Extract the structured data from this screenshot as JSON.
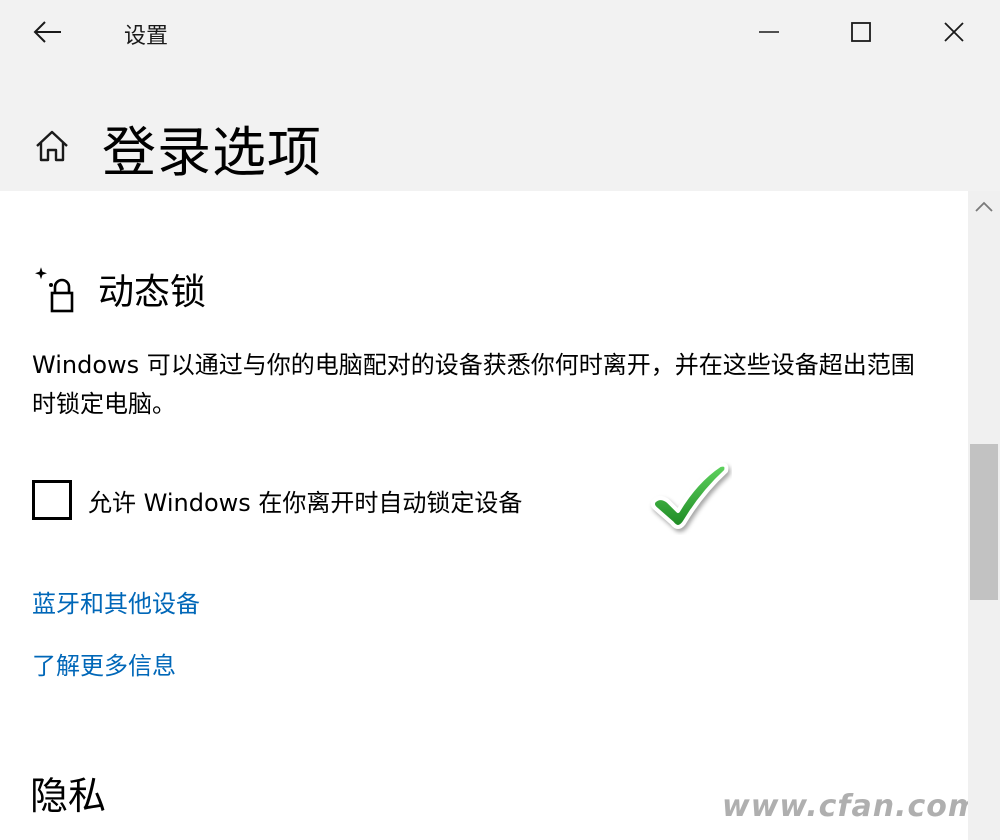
{
  "window": {
    "app_title": "设置"
  },
  "header": {
    "page_title": "登录选项"
  },
  "dynamic_lock": {
    "heading": "动态锁",
    "description": "Windows 可以通过与你的电脑配对的设备获悉你何时离开，并在这些设备超出范围时锁定电脑。",
    "checkbox_label": "允许 Windows 在你离开时自动锁定设备",
    "checkbox_checked": false,
    "links": {
      "bluetooth": "蓝牙和其他设备",
      "learn_more": "了解更多信息"
    }
  },
  "privacy": {
    "heading": "隐私"
  },
  "watermark": "www.cfan.com.cn",
  "icons": [
    "back-arrow-icon",
    "minimize-icon",
    "maximize-icon",
    "close-icon",
    "home-icon",
    "dynamic-lock-icon",
    "green-checkmark-icon",
    "scroll-up-icon"
  ],
  "colors": {
    "link": "#0067b8",
    "top_band": "#f2f2f2",
    "checkmark": "#2ea32e",
    "scrollbar_thumb": "#c2c2c2"
  }
}
